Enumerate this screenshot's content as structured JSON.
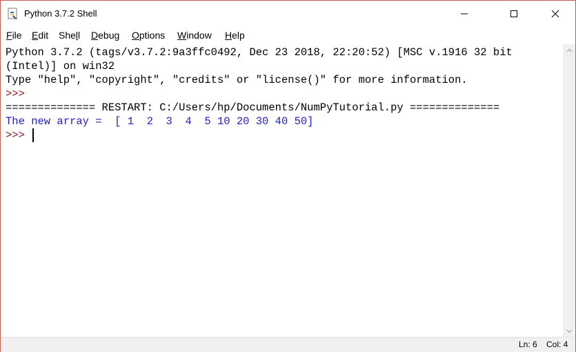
{
  "window": {
    "title": "Python 3.7.2 Shell"
  },
  "menu": [
    {
      "pre": "",
      "u": "F",
      "post": "ile"
    },
    {
      "pre": "",
      "u": "E",
      "post": "dit"
    },
    {
      "pre": "She",
      "u": "l",
      "post": "l"
    },
    {
      "pre": "",
      "u": "D",
      "post": "ebug"
    },
    {
      "pre": "",
      "u": "O",
      "post": "ptions"
    },
    {
      "pre": "",
      "u": "W",
      "post": "indow"
    },
    {
      "pre": "",
      "u": "H",
      "post": "elp"
    }
  ],
  "shell": {
    "lines": [
      "Python 3.7.2 (tags/v3.7.2:9a3ffc0492, Dec 23 2018, 22:20:52) [MSC v.1916 32 bit",
      "(Intel)] on win32",
      "Type \"help\", \"copyright\", \"credits\" or \"license()\" for more information.",
      ">>> ",
      "============== RESTART: C:/Users/hp/Documents/NumPyTutorial.py ==============",
      "The new array =  [ 1  2  3  4  5 10 20 30 40 50]",
      ">>> "
    ]
  },
  "status": {
    "line": "Ln: 6",
    "col": "Col: 4"
  },
  "colors": {
    "prompt": "#8b1a1a",
    "stdout": "#1c1cd9",
    "border": "#c95a52"
  },
  "icons": [
    "python-idle-icon",
    "minimize-icon",
    "maximize-icon",
    "close-icon",
    "scroll-up-icon",
    "scroll-down-icon"
  ]
}
